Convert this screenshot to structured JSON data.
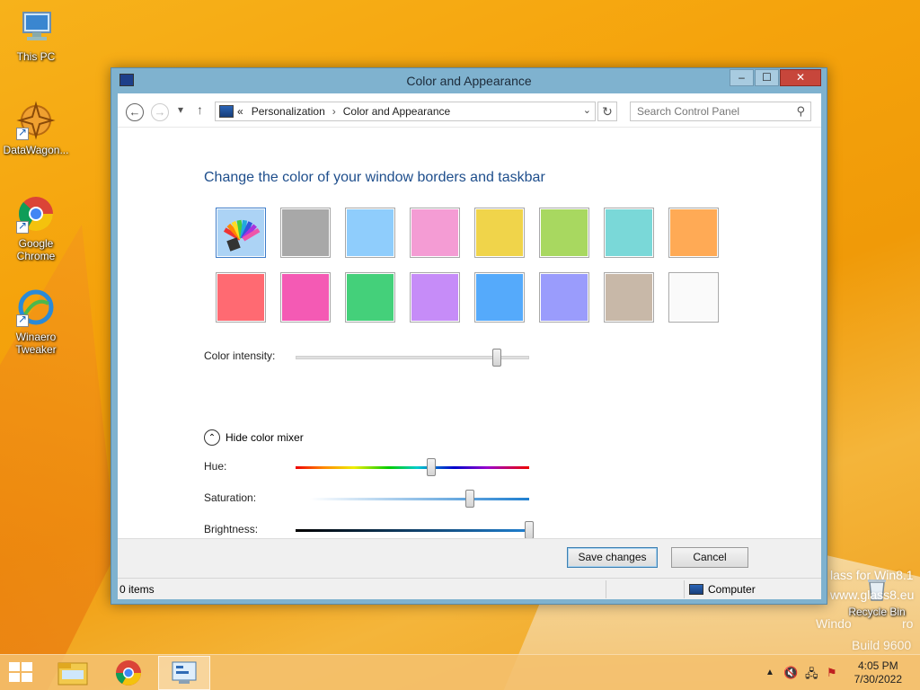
{
  "desktop": {
    "icons": [
      {
        "label": "This PC"
      },
      {
        "label": "DataWagon..."
      },
      {
        "label": "Google Chrome"
      },
      {
        "label": "Winaero Tweaker"
      },
      {
        "label": "Recycle Bin"
      }
    ],
    "watermark": {
      "line1": "lass for Win8.1",
      "line2": "www.glass8.eu",
      "line3": "Windo",
      "line3b": "ro",
      "line4": "Build 9600"
    }
  },
  "window": {
    "title": "Color and Appearance",
    "buttons": {
      "minimize": "–",
      "maximize": "☐",
      "close": "✕"
    },
    "nav": {
      "back": "←",
      "forward": "→",
      "recent": "▾",
      "up": "↑"
    },
    "address": {
      "overflow": "«",
      "crumbs": [
        "Personalization",
        "Color and Appearance"
      ],
      "dropdown": "⌄",
      "refresh": "↻"
    },
    "search": {
      "placeholder": "Search Control Panel",
      "icon": "⚲"
    },
    "heading": "Change the color of your window borders and taskbar",
    "swatches": [
      {
        "name": "automatic",
        "color": "#acd3f5",
        "selected": true
      },
      {
        "name": "gray",
        "color": "#a8a8a8"
      },
      {
        "name": "light-blue",
        "color": "#8fcdfc"
      },
      {
        "name": "pink",
        "color": "#f49cd4"
      },
      {
        "name": "yellow",
        "color": "#f0d44a"
      },
      {
        "name": "green",
        "color": "#a8d860"
      },
      {
        "name": "teal",
        "color": "#7ad8d8"
      },
      {
        "name": "orange",
        "color": "#ffaa55"
      },
      {
        "name": "red",
        "color": "#ff6a72"
      },
      {
        "name": "magenta",
        "color": "#f45ab4"
      },
      {
        "name": "emerald",
        "color": "#44d07a"
      },
      {
        "name": "purple",
        "color": "#c68cf8"
      },
      {
        "name": "blue",
        "color": "#55aafb"
      },
      {
        "name": "periwinkle",
        "color": "#9a9cfc"
      },
      {
        "name": "taupe",
        "color": "#c8b8a8"
      },
      {
        "name": "white",
        "color": "#fafafa"
      }
    ],
    "intensity": {
      "label": "Color intensity:",
      "value": 0.86
    },
    "mixer": {
      "toggle_label": "Hide color mixer",
      "toggle_icon": "⌃",
      "hue": {
        "label": "Hue:",
        "value": 0.58
      },
      "saturation": {
        "label": "Saturation:",
        "value": 0.73
      },
      "brightness": {
        "label": "Brightness:",
        "value": 1.0
      }
    },
    "footer": {
      "save_label": "Save changes",
      "cancel_label": "Cancel"
    },
    "status": {
      "items": "0 items",
      "location": "Computer"
    }
  },
  "taskbar": {
    "time": "4:05 PM",
    "date": "7/30/2022",
    "tray_icons": [
      "▲",
      "🔇",
      "🖧",
      "⚑"
    ]
  }
}
